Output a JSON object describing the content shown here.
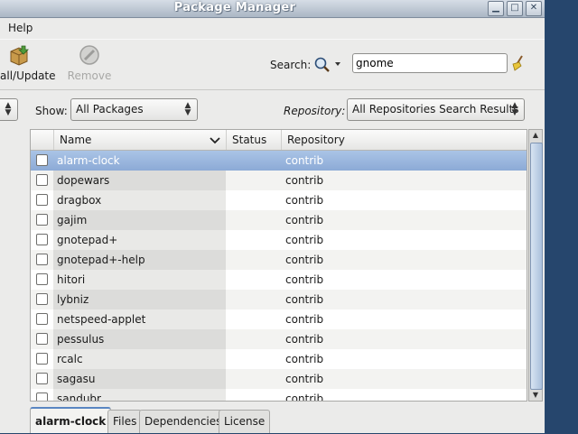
{
  "window": {
    "title": "Package Manager"
  },
  "menu": {
    "help": "Help"
  },
  "toolbar": {
    "install_update": "all/Update",
    "remove": "Remove",
    "search_label": "Search:",
    "search_value": "gnome"
  },
  "filters": {
    "show_label": "Show:",
    "show_value": "All Packages",
    "repository_label": "Repository:",
    "repository_value": "All Repositories Search Results"
  },
  "table": {
    "columns": {
      "name": "Name",
      "status": "Status",
      "repository": "Repository"
    },
    "rows": [
      {
        "name": "alarm-clock",
        "status": "",
        "repository": "contrib"
      },
      {
        "name": "dopewars",
        "status": "",
        "repository": "contrib"
      },
      {
        "name": "dragbox",
        "status": "",
        "repository": "contrib"
      },
      {
        "name": "gajim",
        "status": "",
        "repository": "contrib"
      },
      {
        "name": "gnotepad+",
        "status": "",
        "repository": "contrib"
      },
      {
        "name": "gnotepad+-help",
        "status": "",
        "repository": "contrib"
      },
      {
        "name": "hitori",
        "status": "",
        "repository": "contrib"
      },
      {
        "name": "lybniz",
        "status": "",
        "repository": "contrib"
      },
      {
        "name": "netspeed-applet",
        "status": "",
        "repository": "contrib"
      },
      {
        "name": "pessulus",
        "status": "",
        "repository": "contrib"
      },
      {
        "name": "rcalc",
        "status": "",
        "repository": "contrib"
      },
      {
        "name": "sagasu",
        "status": "",
        "repository": "contrib"
      },
      {
        "name": "sandubr",
        "status": "",
        "repository": "contrib"
      }
    ]
  },
  "tabs": [
    "alarm-clock",
    "Files",
    "Dependencies",
    "License"
  ],
  "colors": {
    "selection": "#8caad6",
    "desktop": "#26466d"
  }
}
